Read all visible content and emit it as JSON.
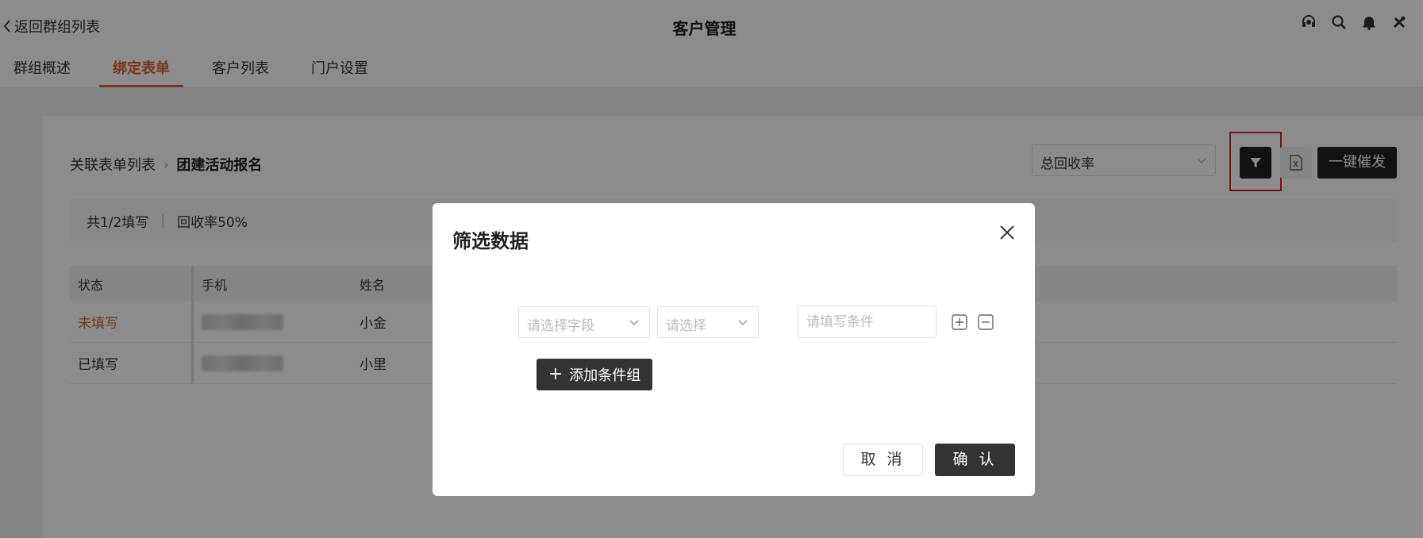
{
  "header": {
    "back_label": "返回群组列表",
    "title": "客户管理",
    "icons": [
      "headset-icon",
      "search-icon",
      "bell-icon",
      "tools-icon"
    ]
  },
  "tabs": [
    {
      "label": "群组概述",
      "active": false
    },
    {
      "label": "绑定表单",
      "active": true
    },
    {
      "label": "客户列表",
      "active": false
    },
    {
      "label": "门户设置",
      "active": false
    }
  ],
  "breadcrumb": {
    "root": "关联表单列表",
    "separator": "›",
    "current": "团建活动报名"
  },
  "toolbar": {
    "rate_select_value": "总回收率",
    "filter_icon": "filter-icon",
    "excel_icon": "excel-export-icon",
    "remind_label": "一键催发"
  },
  "stats": {
    "filled": "共1/2填写",
    "rate": "回收率50%"
  },
  "table": {
    "headers": [
      "状态",
      "手机",
      "姓名"
    ],
    "rows": [
      {
        "status": "未填写",
        "phone": "",
        "name": "小金"
      },
      {
        "status": "已填写",
        "phone": "",
        "name": "小里"
      }
    ]
  },
  "modal": {
    "title": "筛选数据",
    "field_placeholder": "请选择字段",
    "operator_placeholder": "请选择",
    "condition_placeholder": "请填写条件",
    "add_group_label": "添加条件组",
    "cancel_label": "取 消",
    "confirm_label": "确 认"
  },
  "colors": {
    "accent": "#e0632a",
    "primary_dark": "#222222",
    "highlight_border": "#e02020"
  }
}
